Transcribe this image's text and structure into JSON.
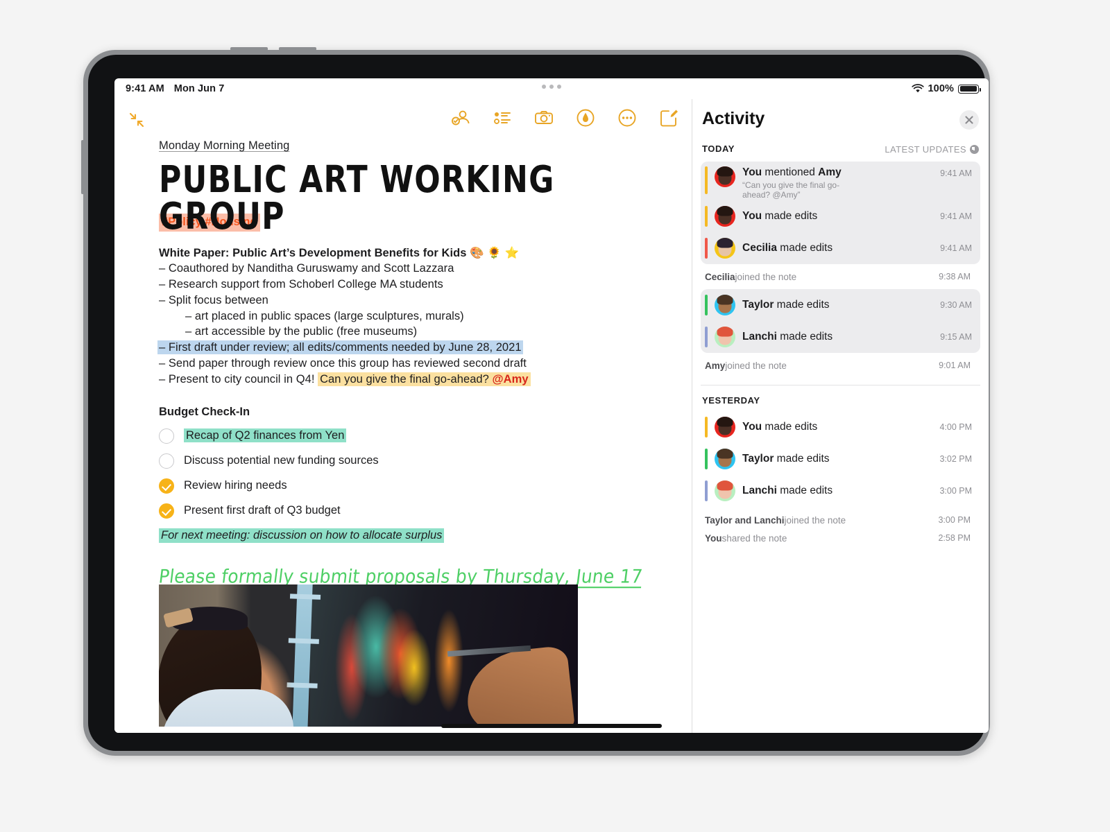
{
  "statusbar": {
    "time": "9:41 AM",
    "date": "Mon Jun 7",
    "battery_pct": "100%",
    "wifi_icon": "wifi-icon",
    "multitask_icon": "multitask-handle-icon"
  },
  "toolbar": {
    "collapse_icon": "collapse-arrows-icon",
    "items": [
      {
        "name": "share-collaborate-icon",
        "label": "Share"
      },
      {
        "name": "checklist-icon",
        "label": "Checklist"
      },
      {
        "name": "camera-icon",
        "label": "Camera"
      },
      {
        "name": "markup-icon",
        "label": "Markup"
      },
      {
        "name": "more-icon",
        "label": "More"
      },
      {
        "name": "compose-icon",
        "label": "New Note"
      }
    ]
  },
  "note": {
    "subtitle": "Monday Morning Meeting",
    "title": "PUBLIC ART WORKING GROUP",
    "tags": "#Policy #Housing",
    "white_paper_heading": "White Paper: Public Art’s Development Benefits for Kids 🎨 🌻 ⭐",
    "bullets": [
      "– Coauthored by Nanditha Guruswamy and Scott Lazzara",
      "– Research support from Schoberl College MA students",
      "– Split focus between"
    ],
    "sub_bullets": [
      "– art placed in public spaces (large sculptures, murals)",
      "– art accessible by the public (free museums)"
    ],
    "highlight_blue_line": "– First draft under review; all edits/comments needed by June 28, 2021",
    "plain_line": "– Send paper through review once this group has reviewed second draft",
    "present_line_prefix": "– Present to city council in Q4! ",
    "present_line_highlight": "Can you give the final go-ahead? ",
    "present_line_mention": "@Amy",
    "budget_heading": "Budget Check-In",
    "checklist": [
      {
        "label": "Recap of Q2 finances from Yen",
        "checked": false,
        "highlight": "green"
      },
      {
        "label": "Discuss potential new funding sources",
        "checked": false,
        "highlight": "none"
      },
      {
        "label": "Review hiring needs",
        "checked": true,
        "highlight": "none"
      },
      {
        "label": "Present first draft of Q3 budget",
        "checked": true,
        "highlight": "none"
      }
    ],
    "next_meeting": "For next meeting: discussion on how to allocate surplus",
    "handwritten_prefix": "Please formally submit proposals by ",
    "handwritten_u1": "Thursday",
    "handwritten_mid": ", ",
    "handwritten_u2": "June 17",
    "photo_alt": "muralist-painting-photo"
  },
  "activity": {
    "title": "Activity",
    "close_icon": "close-icon",
    "today_label": "TODAY",
    "latest_updates_label": "LATEST UPDATES",
    "latest_updates_icon": "info-icon",
    "yesterday_label": "YESTERDAY",
    "today_entries": [
      {
        "name": "You",
        "action": " mentioned ",
        "target": "Amy",
        "quote": "“Can you give the final go-ahead? @Amy”",
        "time": "9:41 AM",
        "bar": "#f5b924",
        "avatar_bg": "#e8251f",
        "avatar_face": "#4a3026",
        "avatar_hair": "#241611"
      },
      {
        "name": "You",
        "action": " made edits",
        "target": "",
        "quote": "",
        "time": "9:41 AM",
        "bar": "#f5b924",
        "avatar_bg": "#e8251f",
        "avatar_face": "#4a3026",
        "avatar_hair": "#241611"
      },
      {
        "name": "Cecilia",
        "action": " made edits",
        "target": "",
        "quote": "",
        "time": "9:41 AM",
        "bar": "#f0584a",
        "avatar_bg": "#f5c518",
        "avatar_face": "#e7c4a6",
        "avatar_hair": "#2b2230"
      }
    ],
    "today_plain_1": {
      "name": "Cecilia",
      "text": " joined the note",
      "time": "9:38 AM"
    },
    "today_entries_2": [
      {
        "name": "Taylor",
        "action": " made edits",
        "target": "",
        "quote": "",
        "time": "9:30 AM",
        "bar": "#35c25e",
        "avatar_bg": "#2ec4f1",
        "avatar_face": "#a7754c",
        "avatar_hair": "#4a3423"
      },
      {
        "name": "Lanchi",
        "action": " made edits",
        "target": "",
        "quote": "",
        "time": "9:15 AM",
        "bar": "#8f9ed2",
        "avatar_bg": "#b9efc0",
        "avatar_face": "#f0c4ad",
        "avatar_hair": "#e0553c"
      }
    ],
    "today_plain_2": {
      "name": "Amy",
      "text": " joined the note",
      "time": "9:01 AM"
    },
    "yesterday_entries": [
      {
        "name": "You",
        "action": " made edits",
        "target": "",
        "quote": "",
        "time": "4:00 PM",
        "bar": "#f5b924",
        "avatar_bg": "#e8251f",
        "avatar_face": "#4a3026",
        "avatar_hair": "#241611"
      },
      {
        "name": "Taylor",
        "action": " made edits",
        "target": "",
        "quote": "",
        "time": "3:02 PM",
        "bar": "#35c25e",
        "avatar_bg": "#2ec4f1",
        "avatar_face": "#a7754c",
        "avatar_hair": "#4a3423"
      },
      {
        "name": "Lanchi",
        "action": " made edits",
        "target": "",
        "quote": "",
        "time": "3:00 PM",
        "bar": "#8f9ed2",
        "avatar_bg": "#b9efc0",
        "avatar_face": "#f0c4ad",
        "avatar_hair": "#e0553c"
      }
    ],
    "yesterday_plain": [
      {
        "name": "Taylor and Lanchi",
        "text": " joined the note",
        "time": "3:00 PM"
      },
      {
        "name": "You",
        "text": " shared the note",
        "time": "2:58 PM"
      }
    ]
  },
  "colors": {
    "accent_yellow": "#e8a525",
    "tag_bg": "#fbbda8",
    "tag_fg": "#f4561f",
    "highlight_blue": "#bdd6ee",
    "highlight_yellow": "#fbe0a0",
    "highlight_green": "#8fe0c8",
    "mention_red": "#d8271a",
    "handwriting_green": "#4ecf65",
    "checkbox_done": "#f7b318"
  }
}
